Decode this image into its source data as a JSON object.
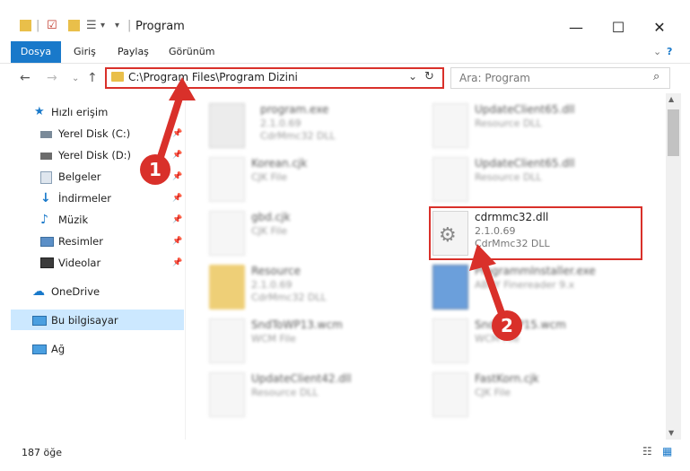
{
  "window": {
    "title": "Program"
  },
  "ribbon": {
    "tabs": [
      "Dosya",
      "Giriş",
      "Paylaş",
      "Görünüm"
    ]
  },
  "address": {
    "path": "C:\\Program Files\\Program Dizini"
  },
  "search": {
    "placeholder": "Ara: Program"
  },
  "sidebar": {
    "items": [
      {
        "label": "Hızlı erişim"
      },
      {
        "label": "Yerel Disk (C:)"
      },
      {
        "label": "Yerel Disk (D:)"
      },
      {
        "label": "Belgeler"
      },
      {
        "label": "İndirmeler"
      },
      {
        "label": "Müzik"
      },
      {
        "label": "Resimler"
      },
      {
        "label": "Videolar"
      },
      {
        "label": "OneDrive"
      },
      {
        "label": "Bu bilgisayar"
      },
      {
        "label": "Ağ"
      }
    ]
  },
  "files": [
    {
      "name": "program.exe",
      "line2": "2.1.0.69",
      "line3": "CdrMmc32 DLL"
    },
    {
      "name": "UpdateClient65.dll",
      "line2": "Resource DLL",
      "line3": ""
    },
    {
      "name": "Korean.cjk",
      "line2": "CJK File",
      "line3": ""
    },
    {
      "name": "UpdateClient65.dll",
      "line2": "Resource DLL",
      "line3": ""
    },
    {
      "name": "gbd.cjk",
      "line2": "CJK File",
      "line3": ""
    },
    {
      "name": "cdrmmc32.dll",
      "line2": "2.1.0.69",
      "line3": "CdrMmc32 DLL"
    },
    {
      "name": "Resource",
      "line2": "2.1.0.69",
      "line3": "CdrMmc32 DLL"
    },
    {
      "name": "ProgrammInstaller.exe",
      "line2": "ABBY Finereader 9.x",
      "line3": ""
    },
    {
      "name": "SndToWP13.wcm",
      "line2": "WCM File",
      "line3": ""
    },
    {
      "name": "SndToWP15.wcm",
      "line2": "WCM File",
      "line3": ""
    },
    {
      "name": "UpdateClient42.dll",
      "line2": "Resource DLL",
      "line3": ""
    },
    {
      "name": "FastKorn.cjk",
      "line2": "CJK File",
      "line3": ""
    }
  ],
  "status": {
    "count": "187 öğe"
  },
  "callouts": {
    "one": "1",
    "two": "2"
  },
  "colors": {
    "accent": "#1979ca",
    "highlight": "#d9302a",
    "selection": "#cce8ff"
  }
}
